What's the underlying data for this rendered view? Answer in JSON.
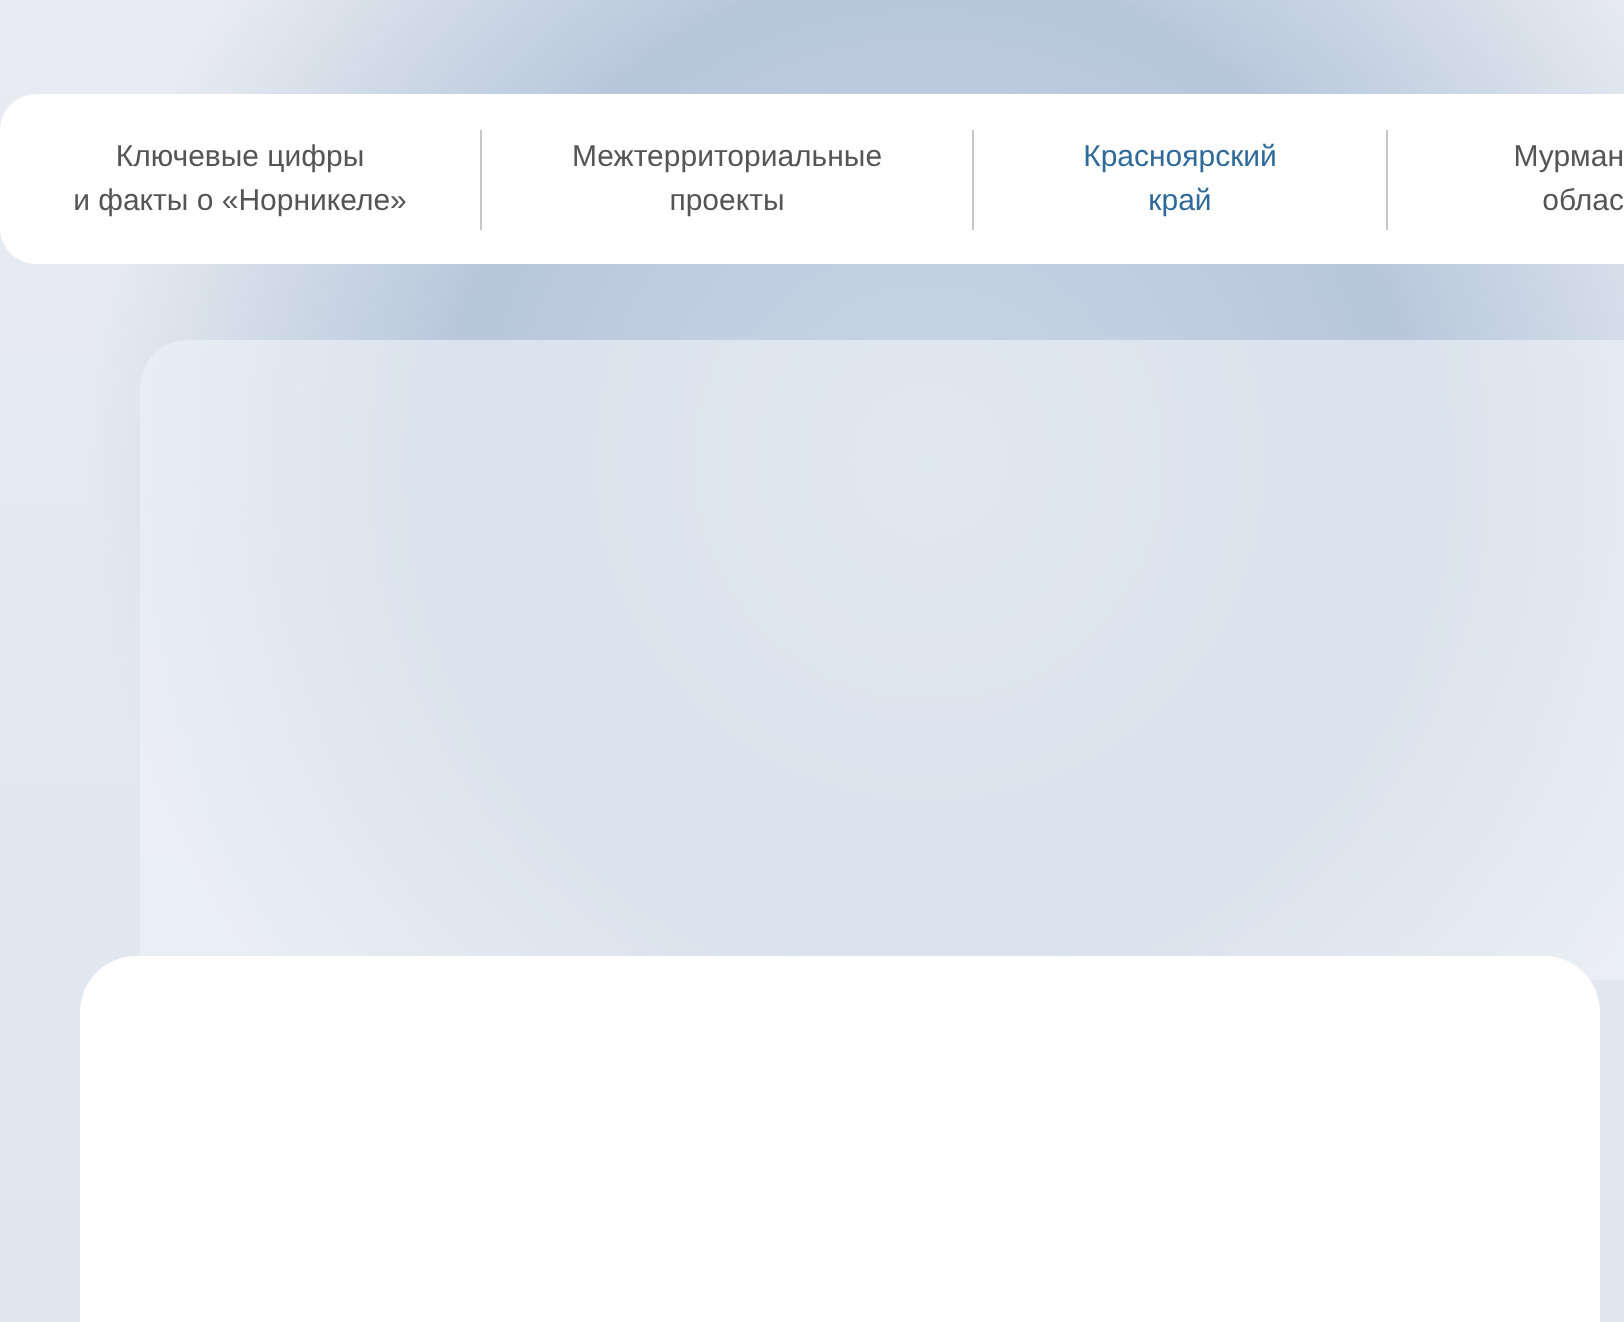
{
  "tabs": [
    {
      "lines": [
        "Ключевые цифры",
        "и факты о «Норникеле»"
      ],
      "selected": false
    },
    {
      "lines": [
        "Межтерриториальные",
        "проекты"
      ],
      "selected": false
    },
    {
      "lines": [
        "Красноярский",
        "край"
      ],
      "selected": true
    },
    {
      "lines": [
        "Мурман",
        "облас"
      ],
      "selected": false
    }
  ]
}
